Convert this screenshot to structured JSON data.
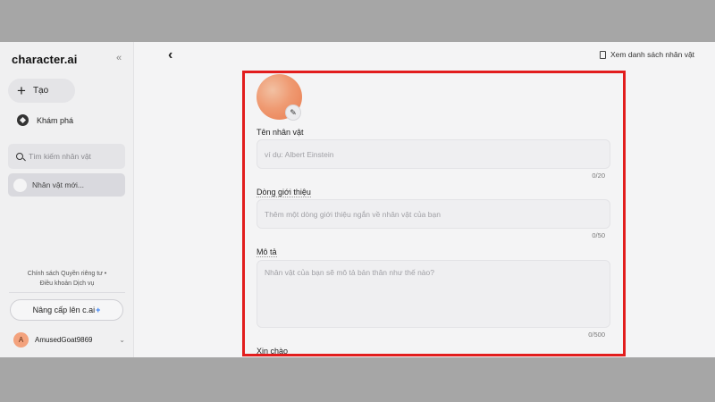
{
  "sidebar": {
    "logo": "character.ai",
    "collapse_icon": "«",
    "create_label": "Tạo",
    "discover_label": "Khám phá",
    "search_placeholder": "Tìm kiếm nhân vật",
    "recent_item": "Nhân vật mới...",
    "policy_line1": "Chính sách Quyền riêng tư  •",
    "policy_line2": "Điều khoản Dịch vụ",
    "upgrade_label": "Nâng cấp lên c.ai",
    "upgrade_plus": "+",
    "user_initial": "A",
    "username": "AmusedGoat9869"
  },
  "header": {
    "back_icon": "‹",
    "view_list_label": "Xem danh sách nhân vật"
  },
  "form": {
    "edit_icon": "✎",
    "name_label": "Tên nhân vật",
    "name_placeholder": "ví dụ: Albert Einstein",
    "name_count": "0/20",
    "tagline_label": "Dòng giới thiệu",
    "tagline_placeholder": "Thêm một dòng giới thiệu ngắn về nhân vật của bạn",
    "tagline_count": "0/50",
    "desc_label": "Mô tả",
    "desc_placeholder": "Nhân vật của bạn sẽ mô tả bản thân như thế nào?",
    "desc_count": "0/500",
    "greeting_label": "Xin chào"
  },
  "colors": {
    "highlight": "#e21d1d",
    "avatar_gradient_start": "#f2c1a3",
    "avatar_gradient_end": "#e97c4f",
    "accent_plus": "#2f7bf5"
  }
}
